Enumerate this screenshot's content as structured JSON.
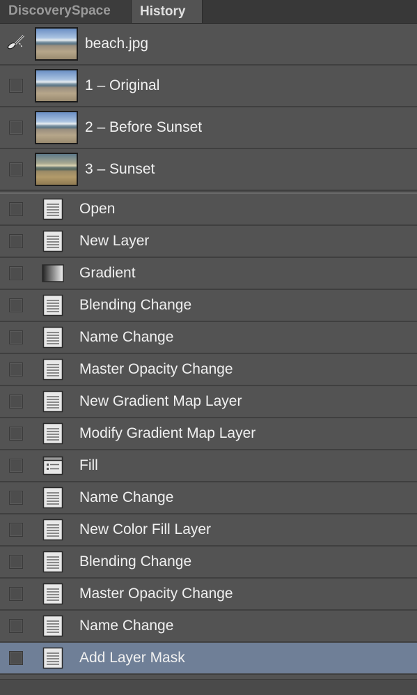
{
  "tabs": [
    {
      "label": "DiscoverySpace",
      "active": false
    },
    {
      "label": "History",
      "active": true
    }
  ],
  "snapshots": [
    {
      "label": "beach.jpg",
      "brush_source": true,
      "tone": "cool"
    },
    {
      "label": "1 – Original",
      "brush_source": false,
      "tone": "cool"
    },
    {
      "label": "2 – Before Sunset",
      "brush_source": false,
      "tone": "cool"
    },
    {
      "label": "3 – Sunset",
      "brush_source": false,
      "tone": "warm"
    }
  ],
  "steps": [
    {
      "label": "Open",
      "icon": "document-icon",
      "selected": false
    },
    {
      "label": "New Layer",
      "icon": "document-icon",
      "selected": false
    },
    {
      "label": "Gradient",
      "icon": "gradient-icon",
      "selected": false
    },
    {
      "label": "Blending Change",
      "icon": "document-icon",
      "selected": false
    },
    {
      "label": "Name Change",
      "icon": "document-icon",
      "selected": false
    },
    {
      "label": "Master Opacity Change",
      "icon": "document-icon",
      "selected": false
    },
    {
      "label": "New Gradient Map Layer",
      "icon": "document-icon",
      "selected": false
    },
    {
      "label": "Modify Gradient Map Layer",
      "icon": "document-icon",
      "selected": false
    },
    {
      "label": "Fill",
      "icon": "fill-icon",
      "selected": false
    },
    {
      "label": "Name Change",
      "icon": "document-icon",
      "selected": false
    },
    {
      "label": "New Color Fill Layer",
      "icon": "document-icon",
      "selected": false
    },
    {
      "label": "Blending Change",
      "icon": "document-icon",
      "selected": false
    },
    {
      "label": "Master Opacity Change",
      "icon": "document-icon",
      "selected": false
    },
    {
      "label": "Name Change",
      "icon": "document-icon",
      "selected": false
    },
    {
      "label": "Add Layer Mask",
      "icon": "document-icon",
      "selected": true
    }
  ],
  "colors": {
    "panel_bg": "#535353",
    "selected_row": "#6f7f97",
    "text": "#f0f0f0"
  }
}
